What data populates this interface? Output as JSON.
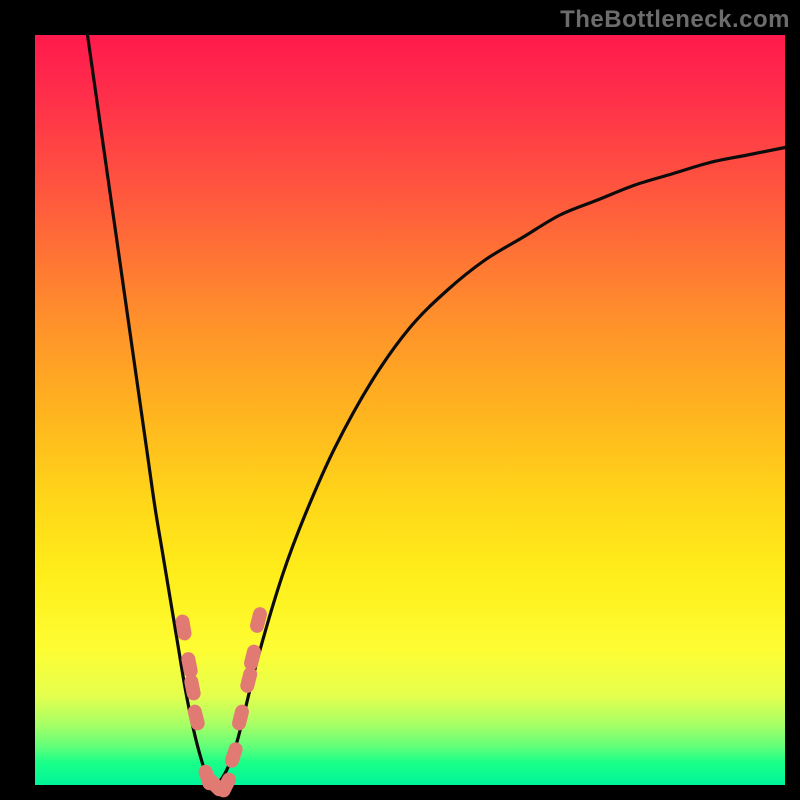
{
  "watermark": "TheBottleneck.com",
  "chart_data": {
    "type": "line",
    "title": "",
    "xlabel": "",
    "ylabel": "",
    "xlim": [
      0,
      100
    ],
    "ylim": [
      0,
      100
    ],
    "series": [
      {
        "name": "bottleneck-curve",
        "x": [
          7,
          8,
          9,
          10,
          11,
          12,
          13,
          14,
          15,
          16,
          17,
          18,
          19,
          20,
          21,
          22,
          23,
          24,
          25,
          26,
          27,
          28,
          30,
          33,
          36,
          40,
          45,
          50,
          55,
          60,
          65,
          70,
          75,
          80,
          85,
          90,
          95,
          100
        ],
        "values": [
          100,
          93,
          86,
          79,
          72,
          65,
          58,
          51,
          44,
          37,
          31,
          25,
          19,
          13,
          8,
          4,
          1,
          0,
          1,
          3,
          6,
          10,
          18,
          28,
          36,
          45,
          54,
          61,
          66,
          70,
          73,
          76,
          78,
          80,
          81.5,
          83,
          84,
          85
        ]
      }
    ],
    "markers": {
      "name": "highlight-dots",
      "x": [
        19.8,
        20.6,
        21.0,
        21.5,
        23.0,
        24.0,
        25.5,
        26.5,
        27.4,
        28.5,
        29.0,
        29.8
      ],
      "values": [
        21,
        16,
        13,
        9,
        1,
        0,
        0,
        4,
        9,
        14,
        17,
        22
      ]
    }
  }
}
